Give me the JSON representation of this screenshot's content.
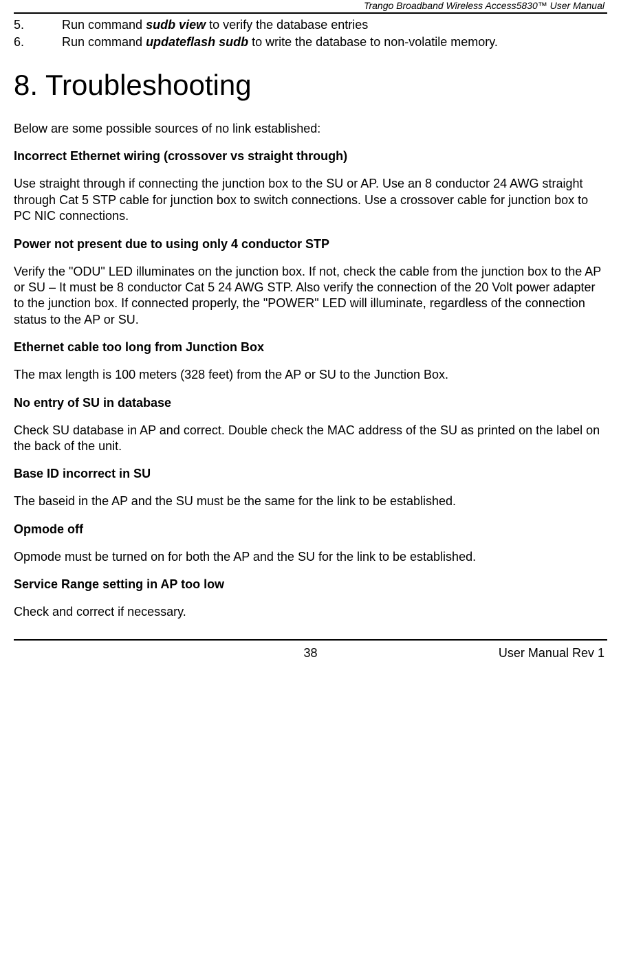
{
  "header": {
    "title": "Trango Broadband Wireless Access5830™  User Manual"
  },
  "list": {
    "item5": {
      "num": "5.",
      "prefix": "Run command  ",
      "cmd": "sudb view",
      "suffix": " to verify the database entries"
    },
    "item6": {
      "num": "6.",
      "prefix": "Run command ",
      "cmd": "updateflash sudb",
      "suffix": " to write the database to non-volatile memory."
    }
  },
  "chapter": {
    "heading": "8.  Troubleshooting"
  },
  "paras": {
    "intro": "Below are some possible sources of no link established:",
    "h1": "Incorrect Ethernet wiring (crossover vs straight through)",
    "p1": "Use straight through if connecting the junction box to the SU or AP.  Use an 8 conductor 24 AWG straight through Cat 5 STP cable for junction box to switch connections.  Use a crossover cable for junction box to PC NIC connections.",
    "h2": "Power not present due to using only 4 conductor STP",
    "p2": "Verify the \"ODU\" LED illuminates on the junction box.  If not, check the cable from the junction box to the AP or SU – It must be 8 conductor Cat 5 24 AWG STP.  Also verify the connection of the 20 Volt power adapter to the junction box.  If connected properly, the \"POWER\" LED will illuminate, regardless of the connection status to the AP or SU.",
    "h3": "Ethernet cable too long from Junction Box",
    "p3": "The max length is 100 meters (328 feet) from the AP or SU to the Junction Box.",
    "h4": "No entry of SU in database",
    "p4": "Check SU database in AP and correct.  Double check the MAC address of the SU as printed on the label on the back of the unit.",
    "h5": "Base ID incorrect in SU",
    "p5": "The baseid in the AP and the SU must be the same for the link to be established.",
    "h6": "Opmode off",
    "p6": "Opmode must be turned on for both the AP and the SU for the link to be established.",
    "h7": "Service Range setting in AP too low",
    "p7": "Check and correct if necessary."
  },
  "footer": {
    "page": "38",
    "right": "User Manual Rev 1"
  }
}
